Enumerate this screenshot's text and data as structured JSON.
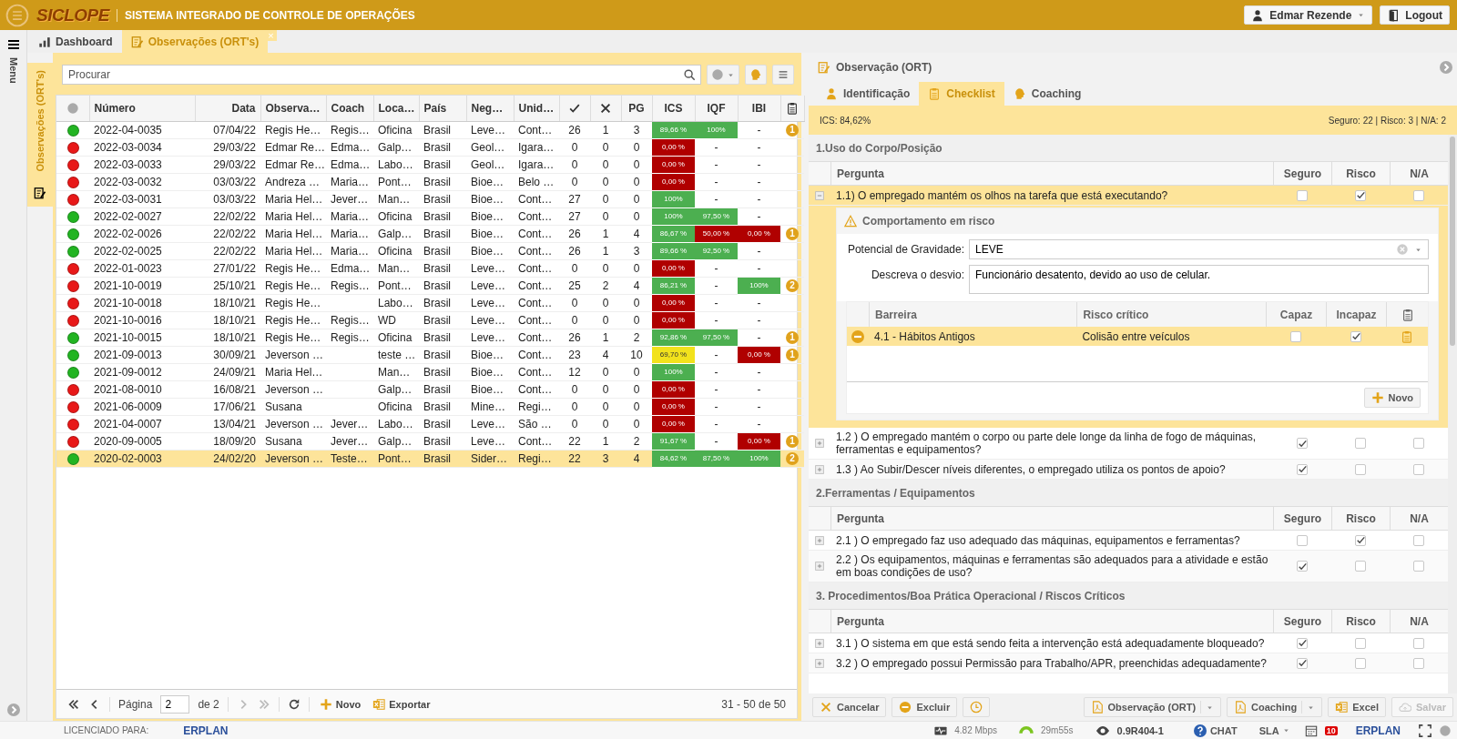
{
  "header": {
    "logo": "SICLOPE",
    "title": "SISTEMA INTEGRADO DE CONTROLE DE OPERAÇÕES",
    "user": "Edmar Rezende",
    "logout": "Logout"
  },
  "sidebar": {
    "menu": "Menu"
  },
  "tabs": [
    {
      "label": "Dashboard",
      "kind": "chart",
      "selected": false
    },
    {
      "label": "Observações (ORT's)",
      "kind": "form",
      "selected": true,
      "close": "×"
    }
  ],
  "side_tab": {
    "label": "Observações (ORT's)"
  },
  "search": {
    "placeholder": "Procurar"
  },
  "table": {
    "columns": [
      {
        "kind": "status"
      },
      {
        "kind": "text",
        "label": "Número"
      },
      {
        "kind": "text",
        "label": "Data"
      },
      {
        "kind": "text",
        "label": "Observa…"
      },
      {
        "kind": "text",
        "label": "Coach"
      },
      {
        "kind": "text",
        "label": "Loca…"
      },
      {
        "kind": "text",
        "label": "País"
      },
      {
        "kind": "text",
        "label": "Neg…"
      },
      {
        "kind": "text",
        "label": "Unid…"
      },
      {
        "kind": "positive"
      },
      {
        "kind": "negative"
      },
      {
        "kind": "text",
        "label": "PG"
      },
      {
        "kind": "text",
        "label": "ICS"
      },
      {
        "kind": "text",
        "label": "IQF"
      },
      {
        "kind": "text",
        "label": "IBI"
      },
      {
        "kind": "attachments"
      }
    ],
    "rows": [
      {
        "color": "#22b422",
        "cells": [
          "",
          "2022-04-0035",
          "07/04/22",
          "Regis He…",
          "Regis…",
          "Oficina",
          "Brasil",
          "Leve…",
          "Cont…",
          "26",
          "1",
          "3",
          {
            "text": "89,66 %",
            "color": "#4caf50"
          },
          {
            "text": "100%",
            "color": "#4caf50"
          },
          "-",
          "1"
        ],
        "selected": false
      },
      {
        "color": "#e81818",
        "cells": [
          "",
          "2022-03-0034",
          "29/03/22",
          "Edmar Re…",
          "Edma…",
          "Galp…",
          "Brasil",
          "Geol…",
          "Igara…",
          "0",
          "0",
          "0",
          {
            "text": "0,00 %",
            "color": "#b00000"
          },
          "-",
          "-",
          ""
        ],
        "selected": false
      },
      {
        "color": "#e81818",
        "cells": [
          "",
          "2022-03-0033",
          "29/03/22",
          "Edmar Re…",
          "Edma…",
          "Labo…",
          "Brasil",
          "Geol…",
          "Igara…",
          "0",
          "0",
          "0",
          {
            "text": "0,00 %",
            "color": "#b00000"
          },
          "-",
          "-",
          ""
        ],
        "selected": false
      },
      {
        "color": "#e81818",
        "cells": [
          "",
          "2022-03-0032",
          "03/03/22",
          "Andreza …",
          "Maria…",
          "Pont…",
          "Brasil",
          "Bioe…",
          "Belo …",
          "0",
          "0",
          "0",
          {
            "text": "0,00 %",
            "color": "#b00000"
          },
          "-",
          "-",
          ""
        ],
        "selected": false
      },
      {
        "color": "#e81818",
        "cells": [
          "",
          "2022-03-0031",
          "03/03/22",
          "Maria Hel…",
          "Jever…",
          "Man…",
          "Brasil",
          "Bioe…",
          "Cont…",
          "27",
          "0",
          "0",
          {
            "text": "100%",
            "color": "#4caf50"
          },
          "-",
          "-",
          ""
        ],
        "selected": false
      },
      {
        "color": "#22b422",
        "cells": [
          "",
          "2022-02-0027",
          "22/02/22",
          "Maria Hel…",
          "Maria…",
          "Oficina",
          "Brasil",
          "Bioe…",
          "Cont…",
          "27",
          "0",
          "0",
          {
            "text": "100%",
            "color": "#4caf50"
          },
          {
            "text": "97,50 %",
            "color": "#4caf50"
          },
          "-",
          ""
        ],
        "selected": false
      },
      {
        "color": "#22b422",
        "cells": [
          "",
          "2022-02-0026",
          "22/02/22",
          "Maria Hel…",
          "Maria…",
          "Galp…",
          "Brasil",
          "Bioe…",
          "Cont…",
          "26",
          "1",
          "4",
          {
            "text": "86,67 %",
            "color": "#4caf50"
          },
          {
            "text": "50,00 %",
            "color": "#b00000"
          },
          {
            "text": "0,00 %",
            "color": "#b00000"
          },
          "1"
        ],
        "selected": false
      },
      {
        "color": "#22b422",
        "cells": [
          "",
          "2022-02-0025",
          "22/02/22",
          "Maria Hel…",
          "Maria…",
          "Oficina",
          "Brasil",
          "Bioe…",
          "Cont…",
          "26",
          "1",
          "3",
          {
            "text": "89,66 %",
            "color": "#4caf50"
          },
          {
            "text": "92,50 %",
            "color": "#4caf50"
          },
          "-",
          ""
        ],
        "selected": false
      },
      {
        "color": "#e81818",
        "cells": [
          "",
          "2022-01-0023",
          "27/01/22",
          "Regis He…",
          "Edma…",
          "Man…",
          "Brasil",
          "Leve…",
          "Cont…",
          "0",
          "0",
          "0",
          {
            "text": "0,00 %",
            "color": "#b00000"
          },
          "-",
          "-",
          ""
        ],
        "selected": false
      },
      {
        "color": "#e81818",
        "cells": [
          "",
          "2021-10-0019",
          "25/10/21",
          "Regis He…",
          "Regis…",
          "Pont…",
          "Brasil",
          "Leve…",
          "Cont…",
          "25",
          "2",
          "4",
          {
            "text": "86,21 %",
            "color": "#4caf50"
          },
          "-",
          {
            "text": "100%",
            "color": "#4caf50"
          },
          "2"
        ],
        "selected": false
      },
      {
        "color": "#e81818",
        "cells": [
          "",
          "2021-10-0018",
          "18/10/21",
          "Regis He…",
          "",
          "Labo…",
          "Brasil",
          "Leve…",
          "Cont…",
          "0",
          "0",
          "0",
          {
            "text": "0,00 %",
            "color": "#b00000"
          },
          "-",
          "-",
          ""
        ],
        "selected": false
      },
      {
        "color": "#e81818",
        "cells": [
          "",
          "2021-10-0016",
          "18/10/21",
          "Regis He…",
          "Regis…",
          "WD",
          "Brasil",
          "Leve…",
          "Cont…",
          "0",
          "0",
          "0",
          {
            "text": "0,00 %",
            "color": "#b00000"
          },
          "-",
          "-",
          ""
        ],
        "selected": false
      },
      {
        "color": "#22b422",
        "cells": [
          "",
          "2021-10-0015",
          "18/10/21",
          "Regis He…",
          "Regis…",
          "Oficina",
          "Brasil",
          "Leve…",
          "Cont…",
          "26",
          "1",
          "2",
          {
            "text": "92,86 %",
            "color": "#4caf50"
          },
          {
            "text": "97,50 %",
            "color": "#4caf50"
          },
          "-",
          "1"
        ],
        "selected": false
      },
      {
        "color": "#22b422",
        "cells": [
          "",
          "2021-09-0013",
          "30/09/21",
          "Jeverson …",
          "",
          "teste …",
          "Brasil",
          "Bioe…",
          "Cont…",
          "23",
          "4",
          "10",
          {
            "text": "69,70 %",
            "color": "#f2e21c"
          },
          "-",
          {
            "text": "0,00 %",
            "color": "#b00000"
          },
          "1"
        ],
        "selected": false
      },
      {
        "color": "#22b422",
        "cells": [
          "",
          "2021-09-0012",
          "24/09/21",
          "Maria Hel…",
          "",
          "Man…",
          "Brasil",
          "Bioe…",
          "Cont…",
          "12",
          "0",
          "0",
          {
            "text": "100%",
            "color": "#4caf50"
          },
          "-",
          "-",
          ""
        ],
        "selected": false
      },
      {
        "color": "#e81818",
        "cells": [
          "",
          "2021-08-0010",
          "16/08/21",
          "Jeverson …",
          "",
          "Galp…",
          "Brasil",
          "Bioe…",
          "Cont…",
          "0",
          "0",
          "0",
          {
            "text": "0,00 %",
            "color": "#b00000"
          },
          "-",
          "-",
          ""
        ],
        "selected": false
      },
      {
        "color": "#e81818",
        "cells": [
          "",
          "2021-06-0009",
          "17/06/21",
          "Susana",
          "",
          "Oficina",
          "Brasil",
          "Mine…",
          "Regi…",
          "0",
          "0",
          "0",
          {
            "text": "0,00 %",
            "color": "#b00000"
          },
          "-",
          "-",
          ""
        ],
        "selected": false
      },
      {
        "color": "#e81818",
        "cells": [
          "",
          "2021-04-0007",
          "13/04/21",
          "Jeverson …",
          "Jever…",
          "Labo…",
          "Brasil",
          "Leve…",
          "São …",
          "0",
          "0",
          "0",
          {
            "text": "0,00 %",
            "color": "#b00000"
          },
          "-",
          "-",
          ""
        ],
        "selected": false
      },
      {
        "color": "#e81818",
        "cells": [
          "",
          "2020-09-0005",
          "18/09/20",
          "Susana",
          "Jever…",
          "Galp…",
          "Brasil",
          "Leve…",
          "Cont…",
          "22",
          "1",
          "2",
          {
            "text": "91,67 %",
            "color": "#4caf50"
          },
          "-",
          {
            "text": "0,00 %",
            "color": "#b00000"
          },
          "1"
        ],
        "selected": false
      },
      {
        "color": "#22b422",
        "cells": [
          "",
          "2020-02-0003",
          "24/02/20",
          "Jeverson …",
          "Teste…",
          "Pont…",
          "Brasil",
          "Sider…",
          "Regi…",
          "22",
          "3",
          "4",
          {
            "text": "84,62 %",
            "color": "#4caf50"
          },
          {
            "text": "87,50 %",
            "color": "#4caf50"
          },
          {
            "text": "100%",
            "color": "#4caf50"
          },
          "2"
        ],
        "selected": true
      }
    ]
  },
  "pager": {
    "page_label": "Página",
    "page": "2",
    "of": "de 2",
    "next_disabled": true,
    "new": "Novo",
    "export": "Exportar",
    "range": "31 - 50 de 50"
  },
  "detail": {
    "title": "Observação (ORT)",
    "tabs": [
      {
        "label": "Identificação",
        "kind": "person",
        "selected": false
      },
      {
        "label": "Checklist",
        "kind": "clipboard",
        "selected": true
      },
      {
        "label": "Coaching",
        "kind": "head",
        "selected": false
      }
    ],
    "summary_left": "ICS: 84,62%",
    "summary_right": "Seguro: 22 | Risco: 3 | N/A: 2",
    "sections": [
      {
        "title": "1.Uso do Corpo/Posição",
        "columns": [
          "Pergunta",
          "Seguro",
          "Risco",
          "N/A"
        ],
        "questions": [
          {
            "text": "1.1) O empregado mantém os olhos na tarefa que está executando?",
            "expanded": true,
            "safe": false,
            "risk": true,
            "na": false,
            "risk_detail": {
              "title": "Comportamento em risco",
              "gravity_label": "Potencial de Gravidade:",
              "gravity": "LEVE",
              "desc_label": "Descreva o desvio:",
              "desc": "Funcionário desatento, devido ao uso de celular.",
              "columns": [
                "Barreira",
                "Risco crítico",
                "Capaz",
                "Incapaz"
              ],
              "rows": [
                {
                  "barrier": "4.1 - Hábitos Antigos",
                  "risk": "Colisão entre veículos",
                  "capable": false,
                  "incapable": true,
                  "selected": true
                }
              ],
              "new": "Novo"
            }
          },
          {
            "text": "1.2 ) O empregado mantém o corpo ou parte dele longe da linha de fogo de máquinas, ferramentas e equipamentos?",
            "expanded": false,
            "safe": true,
            "risk": false,
            "na": false
          },
          {
            "text": "1.3 ) Ao Subir/Descer níveis diferentes, o empregado utiliza os pontos de apoio?",
            "expanded": false,
            "safe": true,
            "risk": false,
            "na": false
          }
        ]
      },
      {
        "title": "2.Ferramentas / Equipamentos",
        "columns": [
          "Pergunta",
          "Seguro",
          "Risco",
          "N/A"
        ],
        "questions": [
          {
            "text": "2.1 ) O empregado faz uso adequado das máquinas, equipamentos e ferramentas?",
            "expanded": false,
            "safe": false,
            "risk": true,
            "na": false
          },
          {
            "text": "2.2 ) Os equipamentos, máquinas e ferramentas são adequados para a atividade e estão em boas condições de uso?",
            "expanded": false,
            "safe": true,
            "risk": false,
            "na": false
          }
        ]
      },
      {
        "title": "3. Procedimentos/Boa Prática Operacional / Riscos Críticos",
        "columns": [
          "Pergunta",
          "Seguro",
          "Risco",
          "N/A"
        ],
        "questions": [
          {
            "text": "3.1 ) O sistema em que está sendo feita a intervenção está adequadamente bloqueado?",
            "expanded": false,
            "safe": true,
            "risk": false,
            "na": false
          },
          {
            "text": "3.2 ) O empregado possui Permissão para Trabalho/APR, preenchidas adequadamente?",
            "expanded": false,
            "safe": true,
            "risk": false,
            "na": false
          }
        ]
      }
    ],
    "buttons_left": [
      {
        "kind": "cancel",
        "label": "Cancelar"
      },
      {
        "kind": "delete",
        "label": "Excluir"
      },
      {
        "kind": "history"
      }
    ],
    "buttons_right": [
      {
        "kind": "pdf",
        "label": "Observação (ORT)",
        "dropdown": true
      },
      {
        "kind": "pdf",
        "label": "Coaching",
        "dropdown": true
      },
      {
        "kind": "excel",
        "label": "Excel"
      },
      {
        "kind": "save",
        "label": "Salvar",
        "disabled": true
      }
    ]
  },
  "status_bar": {
    "license_label": "LICENCIADO PARA:",
    "logo": "ERPLAN",
    "network": "4.82 Mbps",
    "session": "29m55s",
    "version": "0.9R404-1",
    "chat": "CHAT",
    "sla": "SLA",
    "notifications": "10",
    "logo_right": "ERPLAN"
  }
}
